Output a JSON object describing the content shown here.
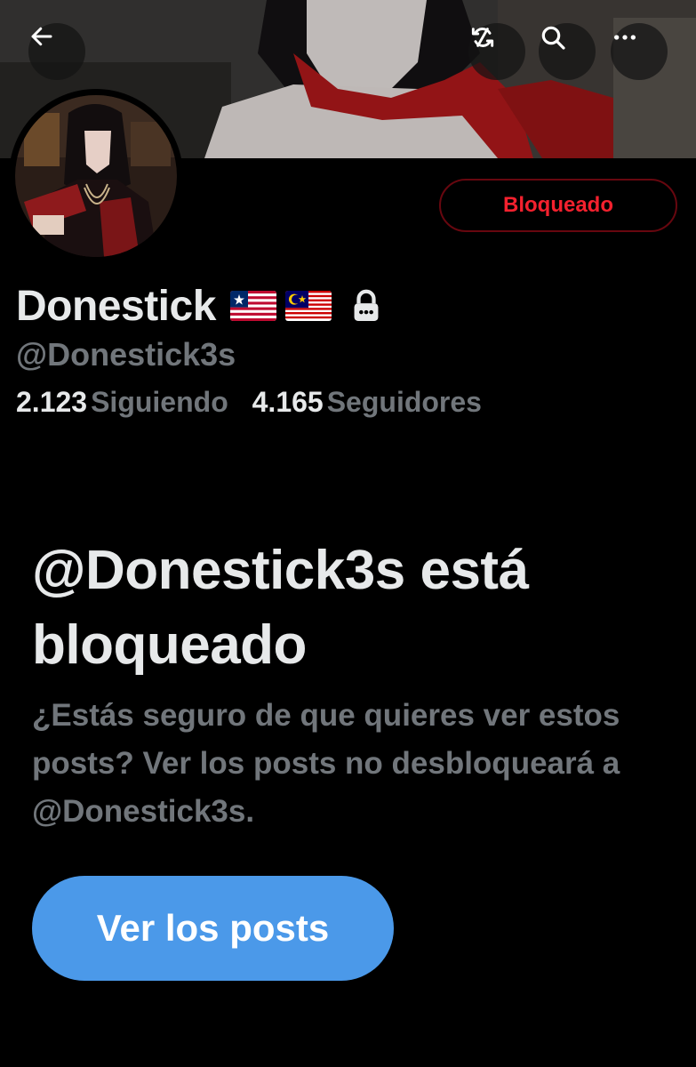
{
  "header": {
    "back_icon": "arrow-left-icon",
    "translate_icon": "no-sync-icon",
    "search_icon": "search-icon",
    "more_icon": "more-horizontal-icon"
  },
  "profile": {
    "display_name": "Donestick",
    "flags": [
      "liberia-flag",
      "malaysia-flag"
    ],
    "protected_icon": "lock-icon",
    "handle": "@Donestick3s",
    "following_count": "2.123",
    "following_label": "Siguiendo",
    "followers_count": "4.165",
    "followers_label": "Seguidores",
    "blocked_button_label": "Bloqueado"
  },
  "blocked_notice": {
    "title": "@Donestick3s está bloqueado",
    "description": "¿Estás seguro de que quieres ver estos posts? Ver los posts no desbloqueará a @Donestick3s.",
    "button_label": "Ver los posts"
  },
  "colors": {
    "background": "#000000",
    "primary_text": "#e7e9ea",
    "secondary_text": "#71767b",
    "blocked_red": "#f4212e",
    "button_blue": "#4b99e9"
  }
}
